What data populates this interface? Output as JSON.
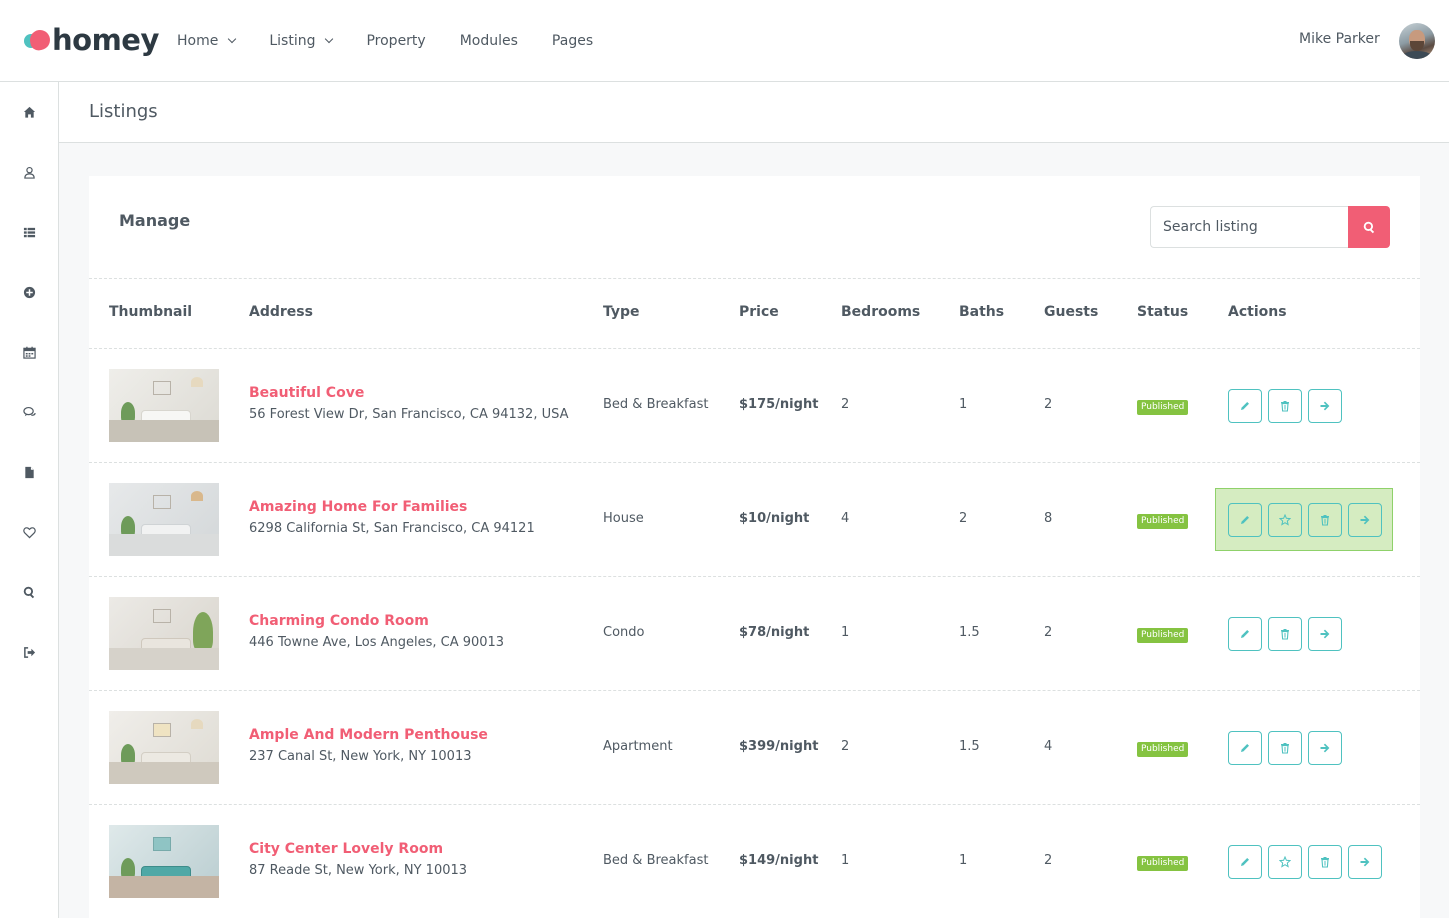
{
  "brand": {
    "name": "homey"
  },
  "nav": [
    {
      "label": "Home",
      "dropdown": true
    },
    {
      "label": "Listing",
      "dropdown": true
    },
    {
      "label": "Property",
      "dropdown": false
    },
    {
      "label": "Modules",
      "dropdown": false
    },
    {
      "label": "Pages",
      "dropdown": false
    }
  ],
  "user": {
    "name": "Mike Parker"
  },
  "sidebar": {
    "icons": [
      "home-icon",
      "user-icon",
      "list-icon",
      "plus-circle-icon",
      "calendar-icon",
      "chat-icon",
      "file-icon",
      "heart-icon",
      "search-icon",
      "logout-icon"
    ]
  },
  "page": {
    "title": "Listings"
  },
  "panel": {
    "title": "Manage",
    "search": {
      "placeholder": "Search listing",
      "value": ""
    }
  },
  "table": {
    "columns": [
      "Thumbnail",
      "Address",
      "Type",
      "Price",
      "Bedrooms",
      "Baths",
      "Guests",
      "Status",
      "Actions"
    ],
    "rows": [
      {
        "title": "Beautiful Cove",
        "address": "56 Forest View Dr, San Francisco, CA 94132, USA",
        "type": "Bed & Breakfast",
        "price": "$175/night",
        "bedrooms": "2",
        "baths": "1",
        "guests": "2",
        "status": "Published",
        "actions": [
          "edit",
          "delete",
          "go"
        ],
        "highlighted": false
      },
      {
        "title": "Amazing Home For Families",
        "address": "6298 California St, San Francisco, CA 94121",
        "type": "House",
        "price": "$10/night",
        "bedrooms": "4",
        "baths": "2",
        "guests": "8",
        "status": "Published",
        "actions": [
          "edit",
          "featured",
          "delete",
          "go"
        ],
        "highlighted": true
      },
      {
        "title": "Charming Condo Room",
        "address": "446 Towne Ave, Los Angeles, CA 90013",
        "type": "Condo",
        "price": "$78/night",
        "bedrooms": "1",
        "baths": "1.5",
        "guests": "2",
        "status": "Published",
        "actions": [
          "edit",
          "delete",
          "go"
        ],
        "highlighted": false
      },
      {
        "title": "Ample And Modern Penthouse",
        "address": "237 Canal St, New York, NY 10013",
        "type": "Apartment",
        "price": "$399/night",
        "bedrooms": "2",
        "baths": "1.5",
        "guests": "4",
        "status": "Published",
        "actions": [
          "edit",
          "delete",
          "go"
        ],
        "highlighted": false
      },
      {
        "title": "City Center Lovely Room",
        "address": "87 Reade St, New York, NY 10013",
        "type": "Bed & Breakfast",
        "price": "$149/night",
        "bedrooms": "1",
        "baths": "1",
        "guests": "2",
        "status": "Published",
        "actions": [
          "edit",
          "featured",
          "delete",
          "go"
        ],
        "highlighted": false
      }
    ]
  },
  "colors": {
    "accent": "#f15e75",
    "teal": "#4fc2c0",
    "published": "#85c341",
    "text": "#4f5962"
  }
}
